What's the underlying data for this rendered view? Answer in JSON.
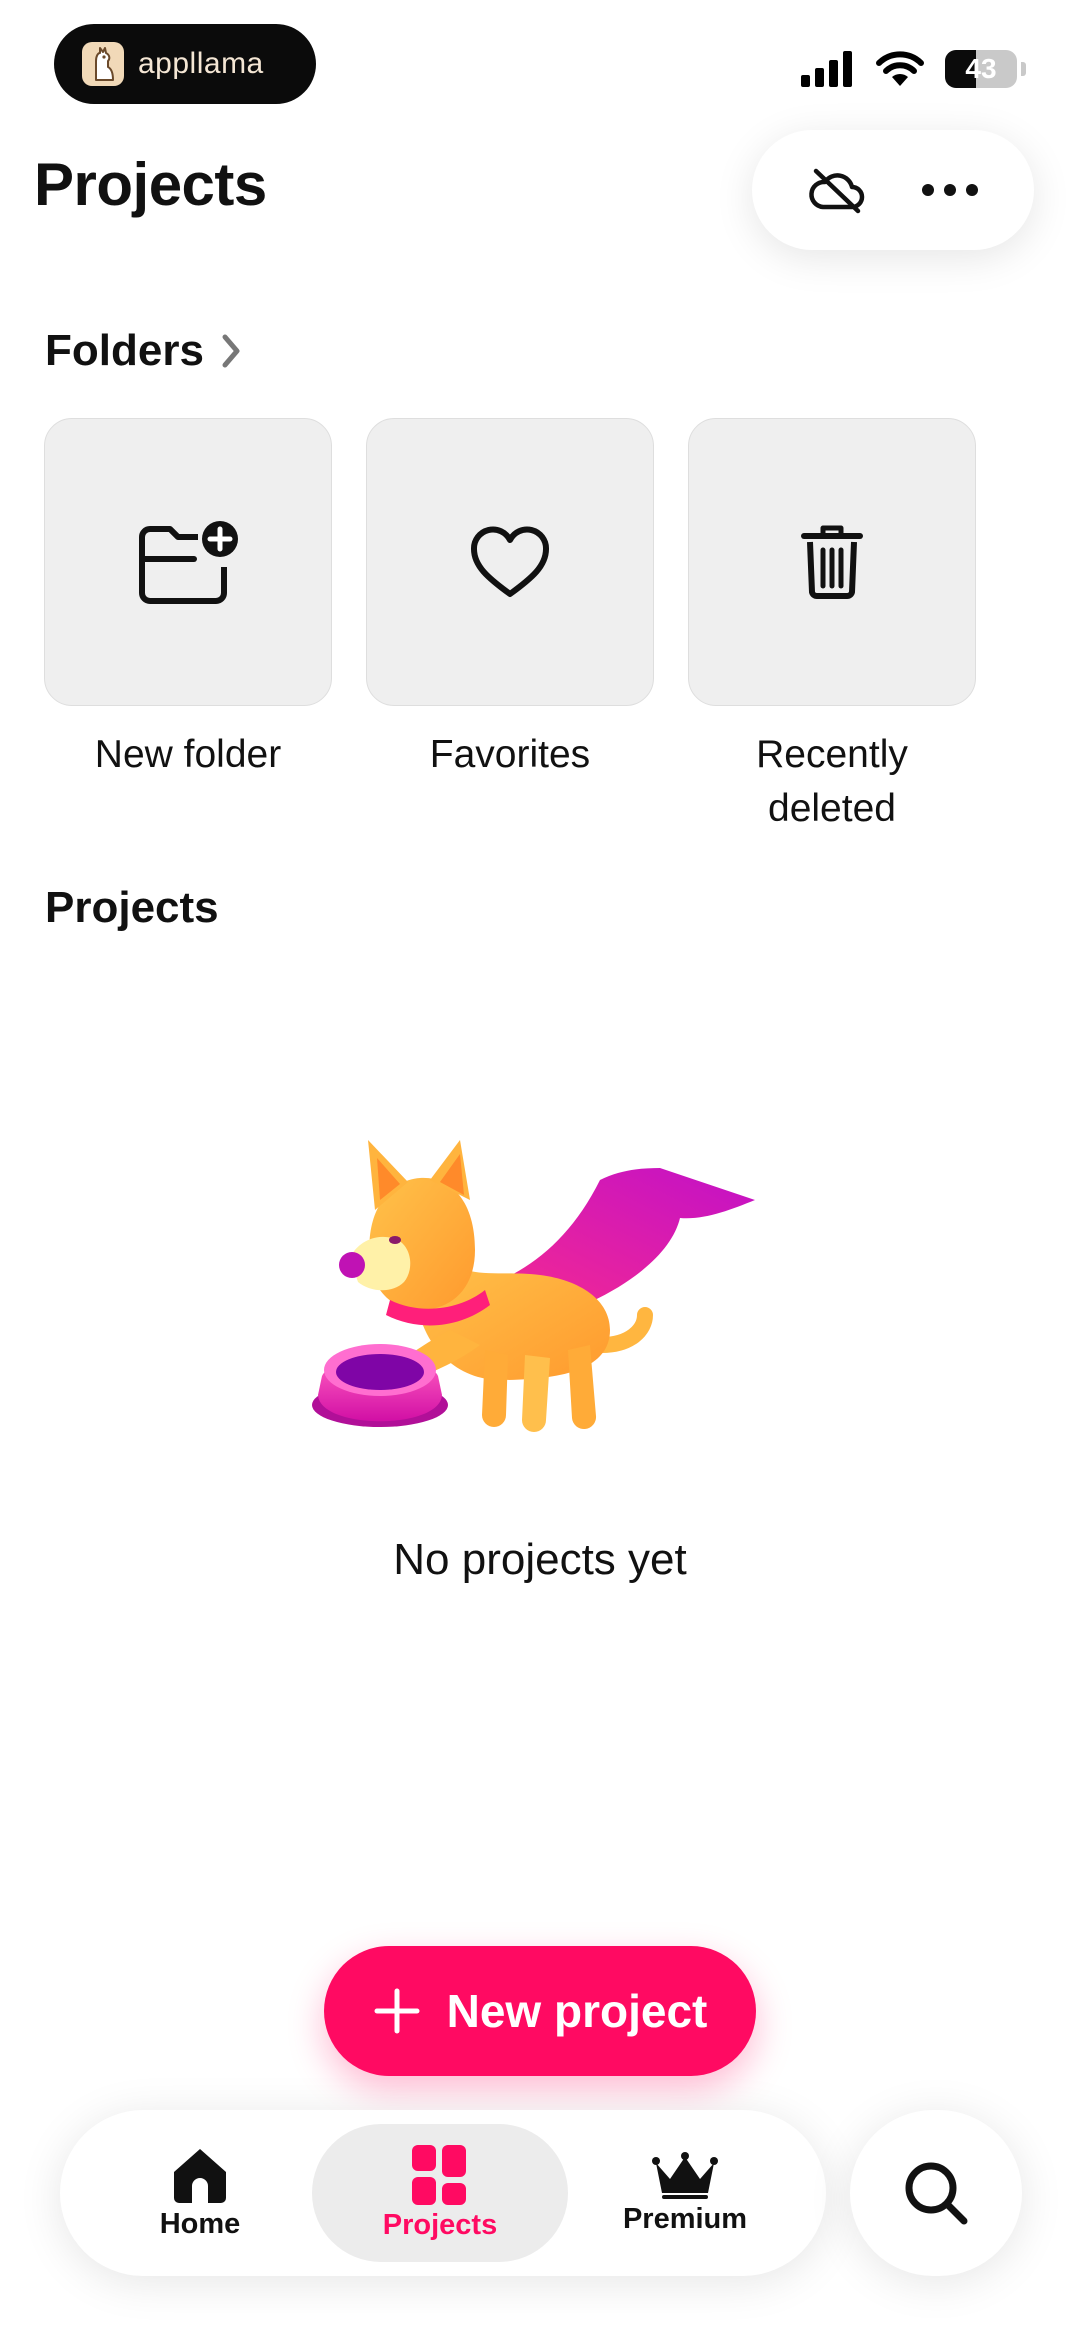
{
  "status_bar": {
    "app_badge": "appllama",
    "battery_level": "43",
    "battery_percent": 43
  },
  "header": {
    "title": "Projects",
    "icons": [
      "cloud-off-icon",
      "more-icon"
    ]
  },
  "folders": {
    "title": "Folders",
    "items": [
      {
        "label": "New folder",
        "icon": "folder-add-icon"
      },
      {
        "label": "Favorites",
        "icon": "heart-icon"
      },
      {
        "label": "Recently deleted",
        "icon": "trash-icon"
      }
    ]
  },
  "projects": {
    "title": "Projects",
    "empty_text": "No projects yet"
  },
  "new_project_button": {
    "label": "New project",
    "color": "#ff0a62"
  },
  "bottom_nav": {
    "items": [
      {
        "label": "Home",
        "icon": "home-icon",
        "active": false
      },
      {
        "label": "Projects",
        "icon": "projects-grid-icon",
        "active": true
      },
      {
        "label": "Premium",
        "icon": "crown-icon",
        "active": false
      }
    ],
    "active_color": "#ff0a62",
    "search_icon": "search-icon"
  }
}
